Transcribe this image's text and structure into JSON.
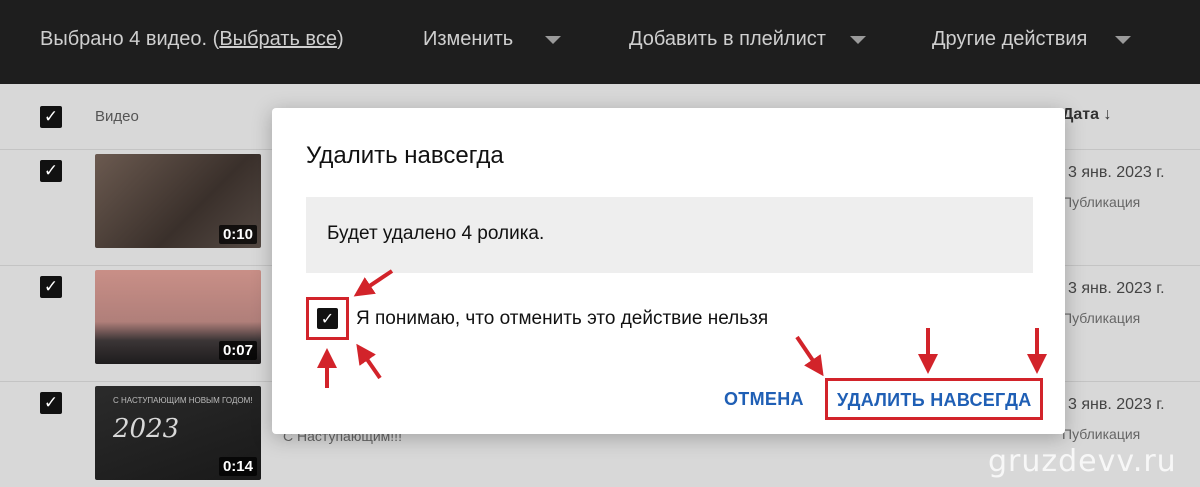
{
  "topbar": {
    "selection_text": "Выбрано 4 видео. (",
    "select_all": "Выбрать все",
    "selection_close": ")",
    "menus": [
      "Изменить",
      "Добавить в плейлист",
      "Другие действия"
    ]
  },
  "table": {
    "col_video": "Видео",
    "col_date": "Дата ↓",
    "rows": [
      {
        "duration": "0:10",
        "date": "3 янв. 2023 г.",
        "status": "Публикация",
        "title": ""
      },
      {
        "duration": "0:07",
        "date": "3 янв. 2023 г.",
        "status": "Публикация",
        "title": ""
      },
      {
        "duration": "0:14",
        "date": "3 янв. 2023 г.",
        "status": "Публикация",
        "title": "С Наступающим!!!",
        "thumb_year": "2023",
        "thumb_caption": "С НАСТУПАЮЩИМ НОВЫМ ГОДОМ!"
      }
    ]
  },
  "dialog": {
    "title": "Удалить навсегда",
    "message": "Будет удалено 4 ролика.",
    "ack_label": "Я понимаю, что отменить это действие нельзя",
    "ack_checked": true,
    "cancel_label": "ОТМЕНА",
    "confirm_label": "УДАЛИТЬ НАВСЕГДА"
  },
  "watermark": "gruzdevv.ru",
  "colors": {
    "annotation": "#d2232a",
    "button_text": "#1f5fb5",
    "topbar_bg": "#1e1e1e"
  }
}
